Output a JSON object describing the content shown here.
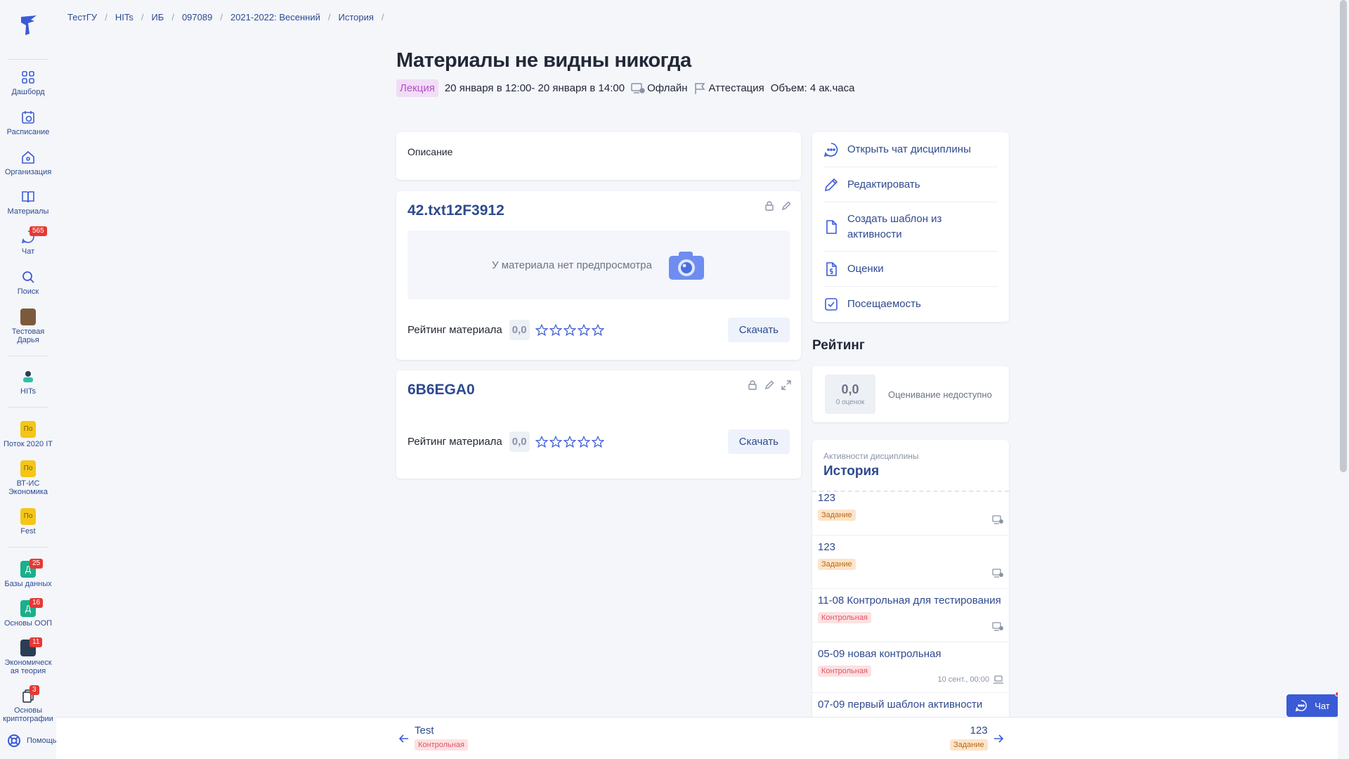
{
  "breadcrumb": [
    "ТестГУ",
    "HITs",
    "ИБ",
    "097089",
    "2021-2022: Весенний",
    "История"
  ],
  "sidebar": {
    "items": [
      {
        "label": "Дашборд",
        "icon": "dashboard-icon"
      },
      {
        "label": "Расписание",
        "icon": "schedule-icon"
      },
      {
        "label": "Организация",
        "icon": "home-icon"
      },
      {
        "label": "Материалы",
        "icon": "book-icon"
      },
      {
        "label": "Чат",
        "icon": "chat-icon",
        "badge": "565"
      },
      {
        "label": "Поиск",
        "icon": "search-icon"
      }
    ],
    "user": {
      "label": "Тестовая Дарья"
    },
    "org": {
      "label": "HITs"
    },
    "groups": [
      {
        "label": "Поток 2020 IT",
        "abbr": "По"
      },
      {
        "label": "ВТ-ИС Экономика",
        "abbr": "По"
      },
      {
        "label": "Fest",
        "abbr": "По"
      }
    ],
    "courses": [
      {
        "label": "Базы данных",
        "abbr": "Д",
        "badge": "25"
      },
      {
        "label": "Основы ООП",
        "abbr": "Д",
        "badge": "16"
      },
      {
        "label": "Экономическ ая теория",
        "badge": "11"
      },
      {
        "label": "Основы криптографии",
        "badge": "3"
      }
    ],
    "help": "Помощь"
  },
  "header": {
    "title": "Материалы не видны никогда",
    "type": "Лекция",
    "dates": "20 января в 12:00- 20 января в 14:00",
    "mode": "Офлайн",
    "attestation": "Аттестация",
    "volume": "Объем: 4 ак.часа"
  },
  "description": {
    "label": "Описание"
  },
  "materials": [
    {
      "title": "42.txt12F3912",
      "preview_text": "У материала нет предпросмотра",
      "rating_label": "Рейтинг материала",
      "rating": "0,0",
      "download": "Скачать"
    },
    {
      "title": "6B6EGA0",
      "rating_label": "Рейтинг материала",
      "rating": "0,0",
      "download": "Скачать"
    }
  ],
  "actions": [
    {
      "label": "Открыть чат дисциплины",
      "icon": "chat-bubble-icon"
    },
    {
      "label": "Редактировать",
      "icon": "pencil-icon"
    },
    {
      "label": "Создать шаблон из активности",
      "icon": "file-icon"
    },
    {
      "label": "Оценки",
      "icon": "grade-file-icon"
    },
    {
      "label": "Посещаемость",
      "icon": "checkbox-icon"
    }
  ],
  "rating": {
    "heading": "Рейтинг",
    "score": "0,0",
    "count": "0 оценок",
    "status": "Оценивание недоступно"
  },
  "activities": {
    "subtitle": "Активности дисциплины",
    "title": "История",
    "items": [
      {
        "name": "123",
        "kind": "Задание",
        "kind_type": "task"
      },
      {
        "name": "123",
        "kind": "Задание",
        "kind_type": "task"
      },
      {
        "name": "11-08 Контрольная для тестирования",
        "kind": "Контрольная",
        "kind_type": "test"
      },
      {
        "name": "05-09 новая контрольная",
        "kind": "Контрольная",
        "kind_type": "test",
        "date": "10 сент., 00:00"
      },
      {
        "name": "07-09 первый шаблон активности"
      }
    ]
  },
  "bottom_nav": {
    "prev": {
      "name": "Test",
      "kind": "Контрольная"
    },
    "next": {
      "name": "123",
      "kind": "Задание"
    }
  },
  "chat_button": "Чат",
  "colors": {
    "accent": "#2e4a8f",
    "chat": "#3b5bd6",
    "badge": "#e53935",
    "lecture_tag": "#b44fc9"
  }
}
